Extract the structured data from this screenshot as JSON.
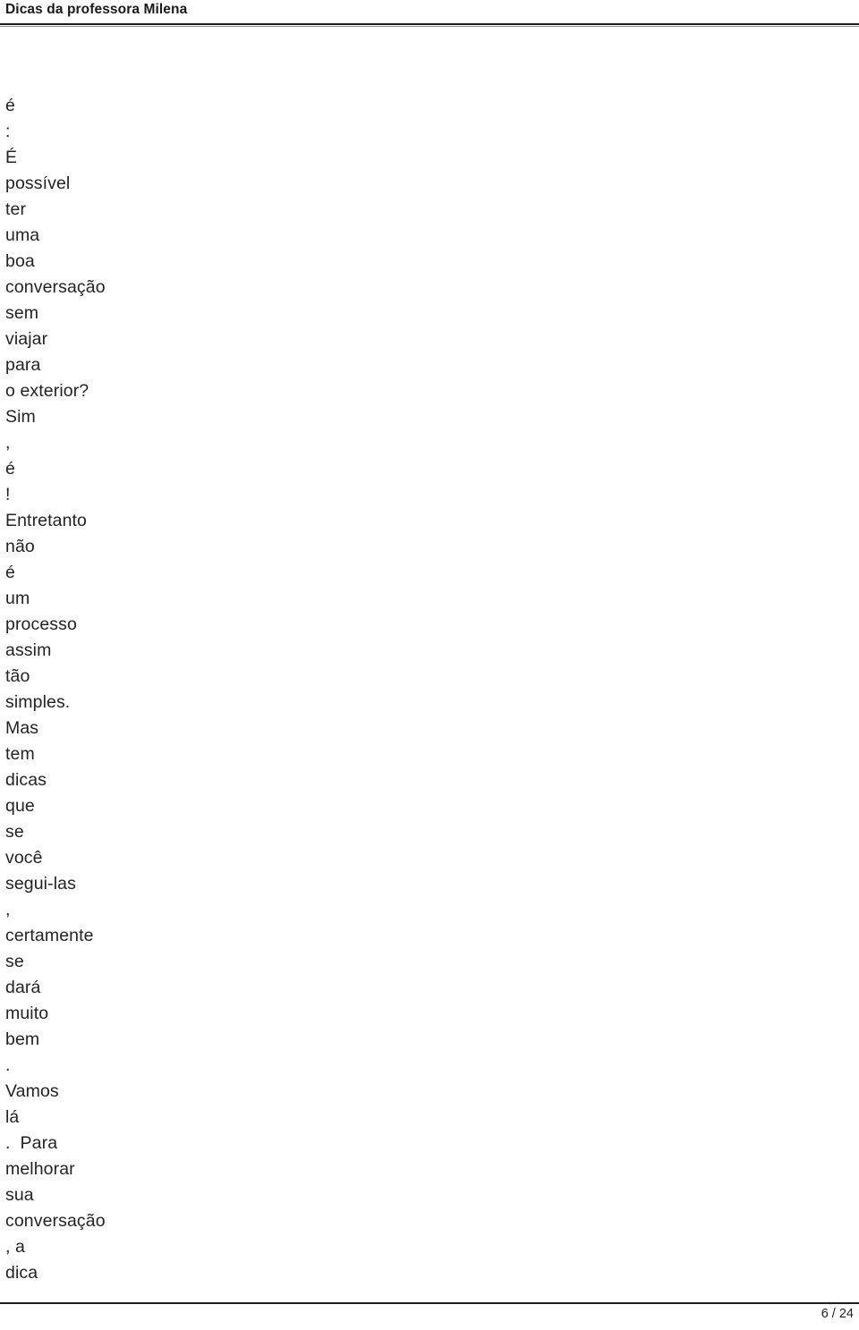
{
  "document": {
    "header": {
      "title": "Dicas da professora Milena"
    },
    "body": {
      "lines": [
        "é",
        ":",
        "É",
        "possível",
        "ter",
        "uma",
        "boa",
        "conversação",
        "sem",
        "viajar",
        "para",
        "o exterior?",
        "Sim",
        ",",
        "é",
        "!",
        "Entretanto",
        "não",
        "é",
        "um",
        "processo",
        "assim",
        "tão",
        "simples.",
        "Mas",
        "tem",
        "dicas",
        "que",
        "se",
        "você",
        "segui-las",
        ",",
        "certamente",
        "se",
        "dará",
        "muito",
        "bem",
        ".",
        "Vamos",
        "lá",
        ".  Para",
        "melhorar",
        "sua",
        "conversação",
        ", a",
        "dica"
      ]
    },
    "footer": {
      "page_label": "6 / 24",
      "current_page": 6,
      "total_pages": 24
    },
    "colors": {
      "text": "#232323",
      "rule": "#1c1c1c",
      "background": "#ffffff"
    }
  }
}
